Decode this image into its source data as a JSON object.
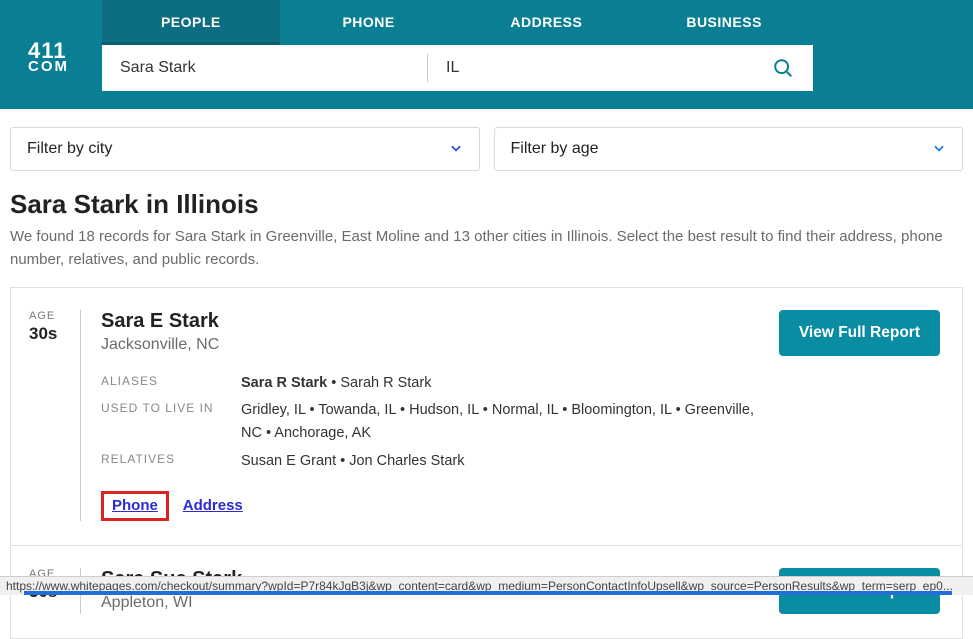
{
  "logo": {
    "line1": "411",
    "line2": "COM"
  },
  "tabs": [
    "PEOPLE",
    "PHONE",
    "ADDRESS",
    "BUSINESS"
  ],
  "search": {
    "name": "Sara Stark",
    "location": "IL"
  },
  "filters": {
    "city": "Filter by city",
    "age": "Filter by age"
  },
  "page": {
    "title": "Sara Stark in Illinois",
    "subtitle": "We found 18 records for Sara Stark in Greenville, East Moline and 13 other cities in Illinois. Select the best result to find their address, phone number, relatives, and public records."
  },
  "labels": {
    "age": "AGE",
    "aliases": "ALIASES",
    "used_to_live_in": "USED TO LIVE IN",
    "relatives": "RELATIVES",
    "view_report": "View Full Report",
    "phone": "Phone",
    "address": "Address"
  },
  "results": [
    {
      "age": "30s",
      "name": "Sara E Stark",
      "location": "Jacksonville, NC",
      "aliases_bold": "Sara R Stark",
      "aliases_rest": " • Sarah R Stark",
      "lived_in": "Gridley, IL • Towanda, IL • Hudson, IL • Normal, IL • Bloomington, IL • Greenville, NC • Anchorage, AK",
      "relatives": "Susan E Grant • Jon Charles Stark"
    },
    {
      "age": "30s",
      "name": "Sara Sue Stark",
      "location": "Appleton, WI"
    }
  ],
  "statusbar": "https://www.whitepages.com/checkout/summary?wpId=P7r84kJqB3j&wp_content=card&wp_medium=PersonContactInfoUpsell&wp_source=PersonResults&wp_term=serp_ep0..."
}
